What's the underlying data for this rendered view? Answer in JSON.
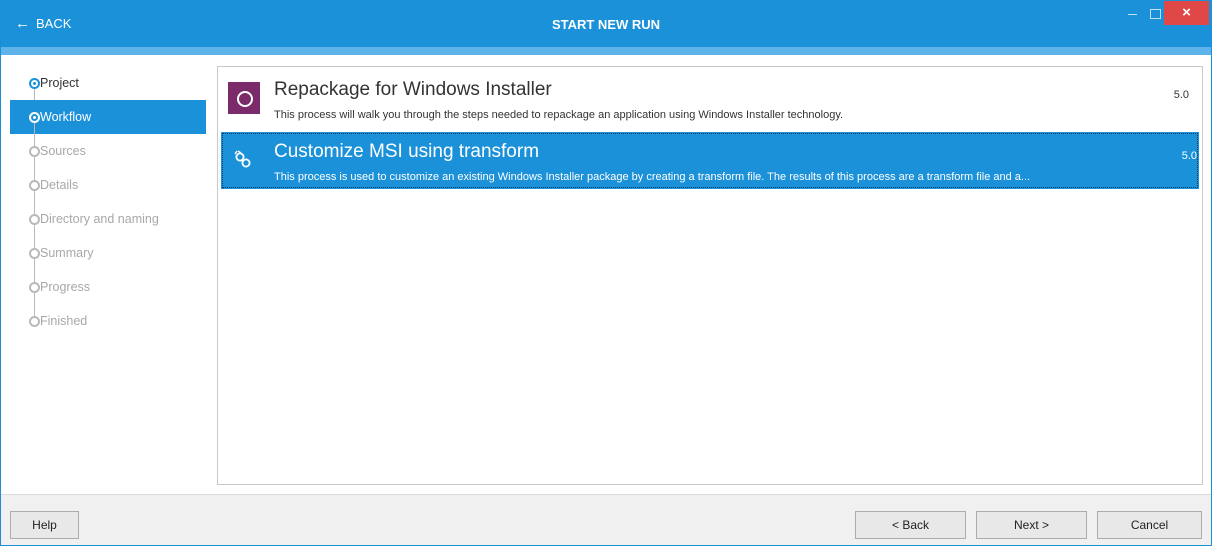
{
  "titlebar": {
    "back_label": "BACK",
    "back_arrow": "←",
    "title": "START NEW RUN",
    "close_glyph": "×"
  },
  "steps": [
    {
      "label": "Project",
      "state": "done"
    },
    {
      "label": "Workflow",
      "state": "active"
    },
    {
      "label": "Sources",
      "state": "pending"
    },
    {
      "label": "Details",
      "state": "pending"
    },
    {
      "label": "Directory and naming",
      "state": "pending"
    },
    {
      "label": "Summary",
      "state": "pending"
    },
    {
      "label": "Progress",
      "state": "pending"
    },
    {
      "label": "Finished",
      "state": "pending"
    }
  ],
  "workflows": [
    {
      "name": "Repackage for Windows Installer",
      "description": "This process will walk you through the steps needed to repackage an application using Windows Installer technology.",
      "version": "5.0",
      "icon": "circle-icon",
      "selected": false
    },
    {
      "name": "Customize MSI using transform",
      "description": "This process is used to customize an existing Windows Installer package by creating a transform file.  The results of this process are a transform file and a...",
      "version": "5.0",
      "icon": "transform-icon",
      "selected": true
    }
  ],
  "footer": {
    "help_label": "Help",
    "back_label": "< Back",
    "next_label": "Next >",
    "cancel_label": "Cancel"
  },
  "colors": {
    "accent": "#1b91d9",
    "stripe": "#5eb3ea",
    "close": "#e04747",
    "workflow_icon_bg": "#7b2a6a"
  }
}
